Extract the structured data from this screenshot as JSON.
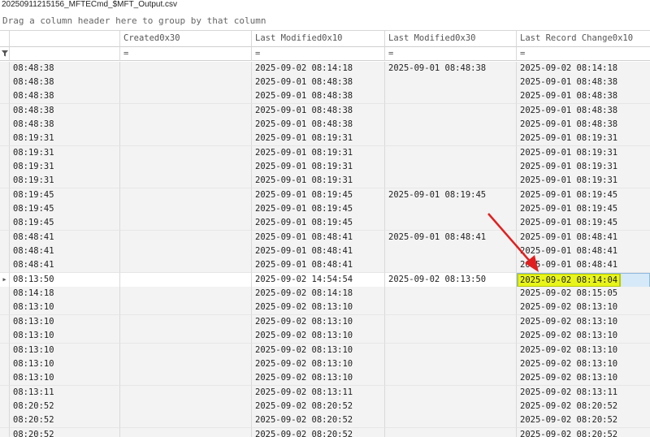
{
  "window": {
    "title": "20250911215156_MFTECmd_$MFT_Output.csv"
  },
  "group_panel": {
    "hint": "Drag a column header here to group by that column"
  },
  "columns": [
    "",
    "Created0x30",
    "Last Modified0x10",
    "Last Modified0x30",
    "Last Record Change0x10"
  ],
  "filter_row": {
    "icon": "funnel-icon",
    "ops": [
      "=",
      "=",
      "=",
      "="
    ]
  },
  "rows": [
    {
      "c1": "08:48:38",
      "c2": "",
      "c3": "2025-09-02 08:14:18",
      "c4": "2025-09-01 08:48:38",
      "c5": "2025-09-02 08:14:18"
    },
    {
      "c1": "08:48:38",
      "c2": "",
      "c3": "2025-09-01 08:48:38",
      "c4": "",
      "c5": "2025-09-01 08:48:38"
    },
    {
      "c1": "08:48:38",
      "c2": "",
      "c3": "2025-09-01 08:48:38",
      "c4": "",
      "c5": "2025-09-01 08:48:38"
    },
    {
      "c1": "08:48:38",
      "c2": "",
      "c3": "2025-09-01 08:48:38",
      "c4": "",
      "c5": "2025-09-01 08:48:38"
    },
    {
      "c1": "08:48:38",
      "c2": "",
      "c3": "2025-09-01 08:48:38",
      "c4": "",
      "c5": "2025-09-01 08:48:38"
    },
    {
      "c1": "08:19:31",
      "c2": "",
      "c3": "2025-09-01 08:19:31",
      "c4": "",
      "c5": "2025-09-01 08:19:31"
    },
    {
      "c1": "08:19:31",
      "c2": "",
      "c3": "2025-09-01 08:19:31",
      "c4": "",
      "c5": "2025-09-01 08:19:31"
    },
    {
      "c1": "08:19:31",
      "c2": "",
      "c3": "2025-09-01 08:19:31",
      "c4": "",
      "c5": "2025-09-01 08:19:31"
    },
    {
      "c1": "08:19:31",
      "c2": "",
      "c3": "2025-09-01 08:19:31",
      "c4": "",
      "c5": "2025-09-01 08:19:31"
    },
    {
      "c1": "08:19:45",
      "c2": "",
      "c3": "2025-09-01 08:19:45",
      "c4": "2025-09-01 08:19:45",
      "c5": "2025-09-01 08:19:45"
    },
    {
      "c1": "08:19:45",
      "c2": "",
      "c3": "2025-09-01 08:19:45",
      "c4": "",
      "c5": "2025-09-01 08:19:45"
    },
    {
      "c1": "08:19:45",
      "c2": "",
      "c3": "2025-09-01 08:19:45",
      "c4": "",
      "c5": "2025-09-01 08:19:45"
    },
    {
      "c1": "08:48:41",
      "c2": "",
      "c3": "2025-09-01 08:48:41",
      "c4": "2025-09-01 08:48:41",
      "c5": "2025-09-01 08:48:41"
    },
    {
      "c1": "08:48:41",
      "c2": "",
      "c3": "2025-09-01 08:48:41",
      "c4": "",
      "c5": "2025-09-01 08:48:41"
    },
    {
      "c1": "08:48:41",
      "c2": "",
      "c3": "2025-09-01 08:48:41",
      "c4": "",
      "c5": "2025-09-01 08:48:41"
    },
    {
      "c1": "08:13:50",
      "c2": "",
      "c3": "2025-09-02 14:54:54",
      "c4": "2025-09-02 08:13:50",
      "c5": "2025-09-02 08:14:04",
      "selected": true
    },
    {
      "c1": "08:14:18",
      "c2": "",
      "c3": "2025-09-02 08:14:18",
      "c4": "",
      "c5": "2025-09-02 08:15:05"
    },
    {
      "c1": "08:13:10",
      "c2": "",
      "c3": "2025-09-02 08:13:10",
      "c4": "",
      "c5": "2025-09-02 08:13:10"
    },
    {
      "c1": "08:13:10",
      "c2": "",
      "c3": "2025-09-02 08:13:10",
      "c4": "",
      "c5": "2025-09-02 08:13:10"
    },
    {
      "c1": "08:13:10",
      "c2": "",
      "c3": "2025-09-02 08:13:10",
      "c4": "",
      "c5": "2025-09-02 08:13:10"
    },
    {
      "c1": "08:13:10",
      "c2": "",
      "c3": "2025-09-02 08:13:10",
      "c4": "",
      "c5": "2025-09-02 08:13:10"
    },
    {
      "c1": "08:13:10",
      "c2": "",
      "c3": "2025-09-02 08:13:10",
      "c4": "",
      "c5": "2025-09-02 08:13:10"
    },
    {
      "c1": "08:13:10",
      "c2": "",
      "c3": "2025-09-02 08:13:10",
      "c4": "",
      "c5": "2025-09-02 08:13:10"
    },
    {
      "c1": "08:13:11",
      "c2": "",
      "c3": "2025-09-02 08:13:11",
      "c4": "",
      "c5": "2025-09-02 08:13:11"
    },
    {
      "c1": "08:20:52",
      "c2": "",
      "c3": "2025-09-02 08:20:52",
      "c4": "",
      "c5": "2025-09-02 08:20:52"
    },
    {
      "c1": "08:20:52",
      "c2": "",
      "c3": "2025-09-02 08:20:52",
      "c4": "",
      "c5": "2025-09-02 08:20:52"
    },
    {
      "c1": "08:20:52",
      "c2": "",
      "c3": "2025-09-02 08:20:52",
      "c4": "",
      "c5": "2025-09-02 08:20:52"
    }
  ],
  "colors": {
    "highlight": "#e8f51a",
    "arrow": "#e02020",
    "selection": "#d6e9f8"
  }
}
